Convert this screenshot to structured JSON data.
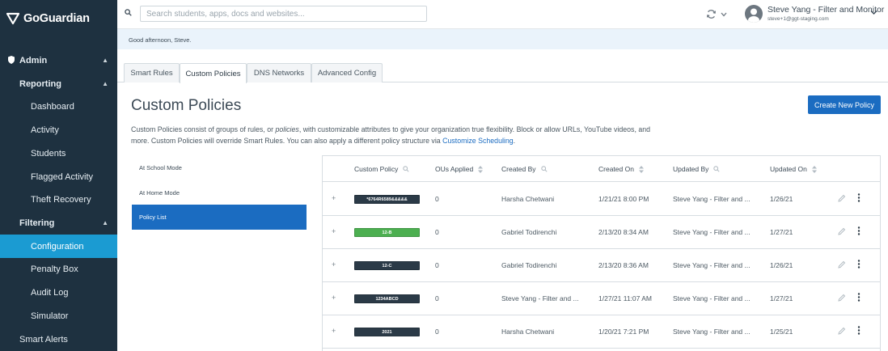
{
  "app": {
    "brand": "GoGuardian"
  },
  "sidebar": {
    "admin": "Admin",
    "reporting": "Reporting",
    "reporting_items": [
      "Dashboard",
      "Activity",
      "Students",
      "Flagged Activity",
      "Theft Recovery"
    ],
    "filtering": "Filtering",
    "filtering_items": [
      "Configuration",
      "Penalty Box",
      "Audit Log",
      "Simulator"
    ],
    "smart_alerts": "Smart Alerts",
    "active_item": "Configuration"
  },
  "topbar": {
    "search_placeholder": "Search students, apps, docs and websites...",
    "user_name": "Steve Yang - Filter and Monitor",
    "user_email": "steve+1@ggt-staging.com"
  },
  "greeting": "Good afternoon, Steve.",
  "tabs": [
    "Smart Rules",
    "Custom Policies",
    "DNS Networks",
    "Advanced Config"
  ],
  "active_tab": "Custom Policies",
  "page": {
    "title": "Custom Policies",
    "create_button": "Create New Policy",
    "description_1": "Custom Policies consist of groups of rules, or ",
    "description_em": "policies",
    "description_2": ", with customizable attributes to give your organization true flexibility. Block or allow URLs, YouTube videos, and more. Custom Policies will override Smart Rules. You can also apply a different policy structure via ",
    "description_link": "Customize Scheduling",
    "description_end": "."
  },
  "modes": [
    "At School Mode",
    "At Home Mode",
    "Policy List"
  ],
  "active_mode": "Policy List",
  "table": {
    "headers": [
      "Custom Policy",
      "OUs Applied",
      "Created By",
      "Created On",
      "Updated By",
      "Updated On"
    ],
    "rows": [
      {
        "policy": "*6764R6589&&&&&",
        "color": "#2b3a47",
        "ous": "0",
        "created_by": "Harsha Chetwani",
        "created_on": "1/21/21 8:00 PM",
        "updated_by": "Steve Yang - Filter and ...",
        "updated_on": "1/26/21"
      },
      {
        "policy": "12-B",
        "color": "#4caf50",
        "ous": "0",
        "created_by": "Gabriel Todirenchi",
        "created_on": "2/13/20 8:34 AM",
        "updated_by": "Steve Yang - Filter and ...",
        "updated_on": "1/27/21"
      },
      {
        "policy": "12-C",
        "color": "#2b3a47",
        "ous": "0",
        "created_by": "Gabriel Todirenchi",
        "created_on": "2/13/20 8:36 AM",
        "updated_by": "Steve Yang - Filter and ...",
        "updated_on": "1/26/21"
      },
      {
        "policy": "1234ABCD",
        "color": "#2b3a47",
        "ous": "0",
        "created_by": "Steve Yang - Filter and ...",
        "created_on": "1/27/21 11:07 AM",
        "updated_by": "Steve Yang - Filter and ...",
        "updated_on": "1/27/21"
      },
      {
        "policy": "2021",
        "color": "#2b3a47",
        "ous": "0",
        "created_by": "Harsha Chetwani",
        "created_on": "1/20/21 7:21 PM",
        "updated_by": "Steve Yang - Filter and ...",
        "updated_on": "1/25/21"
      }
    ]
  },
  "colors": {
    "sidebar_bg": "#1e3140",
    "accent": "#1b9bd2",
    "primary_button": "#1b6cc1"
  },
  "icons": {
    "search": "search-icon",
    "sync": "sync-icon",
    "user": "user-avatar-icon",
    "edit": "pencil-icon",
    "more": "more-vertical-icon",
    "expand": "plus-icon",
    "sort": "sort-icon",
    "admin": "shield-icon"
  }
}
